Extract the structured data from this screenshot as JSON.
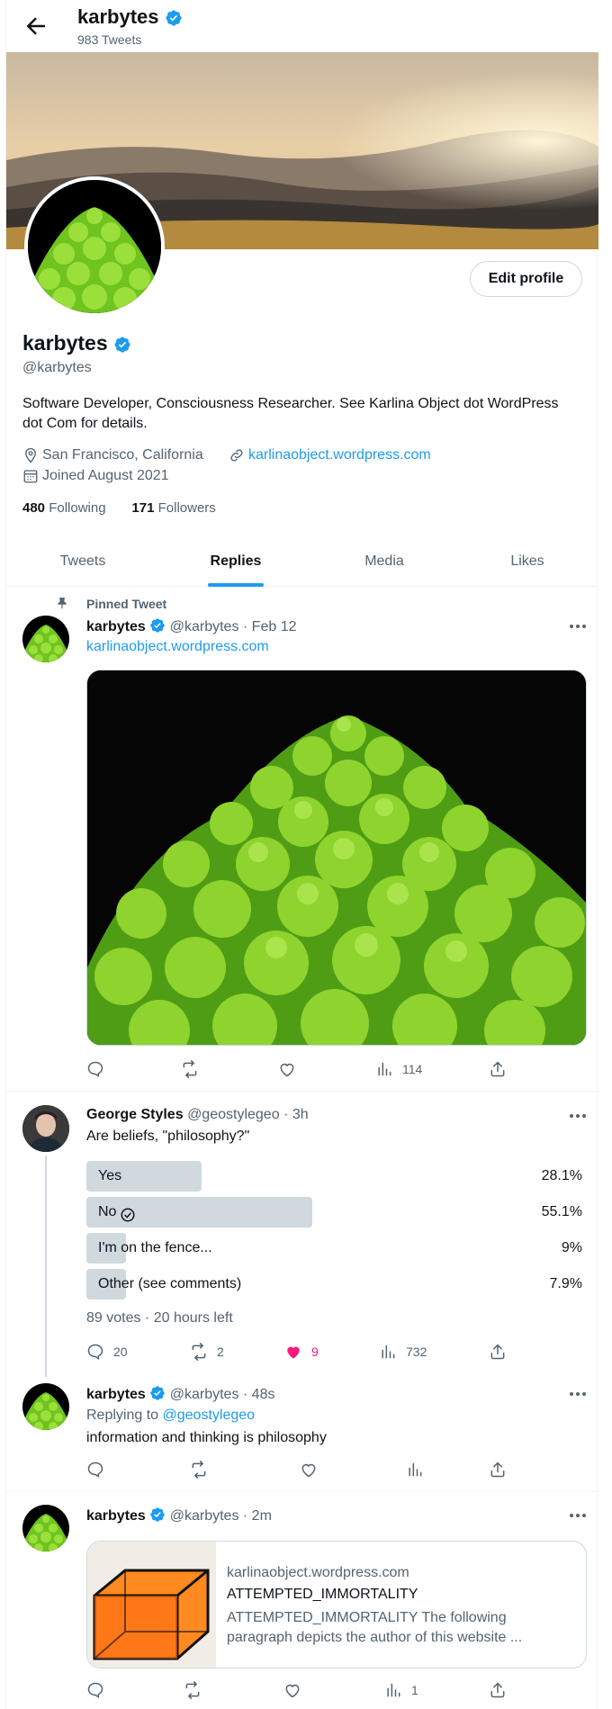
{
  "header": {
    "name": "karbytes",
    "tweet_count": "983 Tweets"
  },
  "profile": {
    "name": "karbytes",
    "handle": "@karbytes",
    "bio": "Software Developer, Consciousness Researcher. See Karlina Object dot WordPress dot Com for details.",
    "location": "San Francisco, California",
    "website": "karlinaobject.wordpress.com",
    "joined": "Joined August 2021",
    "following_count": "480",
    "following_label": "Following",
    "followers_count": "171",
    "followers_label": "Followers",
    "edit_label": "Edit profile"
  },
  "tabs": [
    {
      "label": "Tweets",
      "active": false
    },
    {
      "label": "Replies",
      "active": true
    },
    {
      "label": "Media",
      "active": false
    },
    {
      "label": "Likes",
      "active": false
    }
  ],
  "tweets": [
    {
      "pinned_label": "Pinned Tweet",
      "name": "karbytes",
      "handle": "@karbytes",
      "time": "Feb 12",
      "text": "karlinaobject.wordpress.com",
      "views": "114"
    },
    {
      "name": "George Styles",
      "handle": "@geostylegeo",
      "time": "3h",
      "text": "Are beliefs, \"philosophy?\"",
      "poll": [
        {
          "label": "Yes",
          "pct": "28.1%",
          "value": 28.1,
          "selected": false
        },
        {
          "label": "No",
          "pct": "55.1%",
          "value": 55.1,
          "selected": true
        },
        {
          "label": "I'm on the fence...",
          "pct": "9%",
          "value": 9,
          "selected": false
        },
        {
          "label": "Other (see comments)",
          "pct": "7.9%",
          "value": 7.9,
          "selected": false
        }
      ],
      "poll_meta": "89 votes · 20 hours left",
      "replies": "20",
      "retweets": "2",
      "likes": "9",
      "views": "732"
    },
    {
      "name": "karbytes",
      "handle": "@karbytes",
      "time": "48s",
      "replying_prefix": "Replying to",
      "replying_to": "@geostylegeo",
      "text": "information and thinking is philosophy"
    },
    {
      "name": "karbytes",
      "handle": "@karbytes",
      "time": "2m",
      "card": {
        "domain": "karlinaobject.wordpress.com",
        "title": "ATTEMPTED_IMMORTALITY",
        "description": "ATTEMPTED_IMMORTALITY The following paragraph depicts the author of this website ..."
      },
      "views": "1"
    }
  ],
  "colors": {
    "accent": "#1d9bf0",
    "like": "#f91880",
    "text": "#0f1419",
    "muted": "#536471"
  }
}
